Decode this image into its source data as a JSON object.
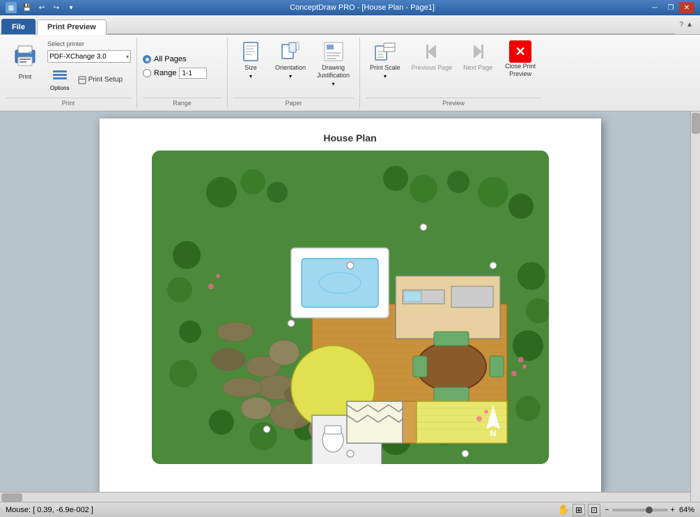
{
  "titlebar": {
    "title": "ConceptDraw PRO - [House Plan - Page1]",
    "icons": [
      "save",
      "undo",
      "redo"
    ]
  },
  "tabs": [
    {
      "id": "file",
      "label": "File",
      "active": false,
      "isFile": true
    },
    {
      "id": "print-preview",
      "label": "Print Preview",
      "active": true,
      "isFile": false
    }
  ],
  "ribbon": {
    "groups": [
      {
        "id": "print",
        "label": "Print",
        "printer_label": "Select printer",
        "printer_value": "PDF-XChange 3.0",
        "print_button": "Print",
        "options_button": "Options",
        "setup_button": "Print Setup"
      },
      {
        "id": "range",
        "label": "Range",
        "all_pages_label": "All Pages",
        "range_label": "Range",
        "range_value": "1-1"
      },
      {
        "id": "paper",
        "label": "Paper",
        "size_label": "Size",
        "orientation_label": "Orientation",
        "drawing_just_label": "Drawing\nJustification"
      },
      {
        "id": "preview",
        "label": "Preview",
        "print_scale_label": "Print\nScale",
        "prev_page_label": "Previous\nPage",
        "next_page_label": "Next\nPage",
        "close_label": "Close Print\nPreview"
      }
    ]
  },
  "page": {
    "title": "House Plan"
  },
  "statusbar": {
    "mouse_coords": "Mouse: [ 0.39, -6.9e-002 ]",
    "zoom": "64%",
    "status_icons": [
      "hand",
      "zoom-fit",
      "zoom-box",
      "minus",
      "plus"
    ]
  }
}
